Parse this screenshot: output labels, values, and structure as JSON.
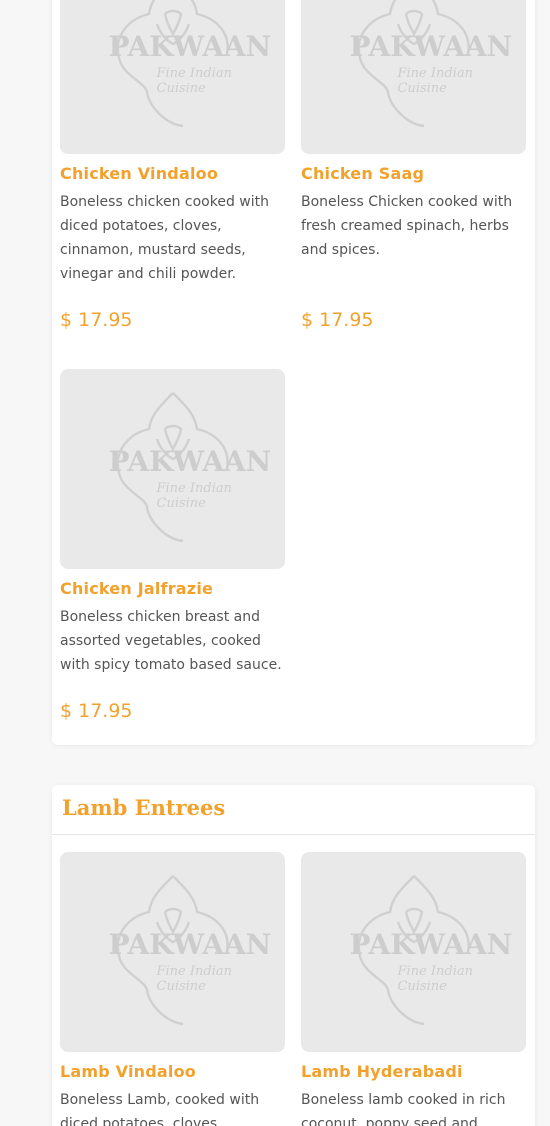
{
  "logo": {
    "brand": "PAKWAAN",
    "tagline": "Fine Indian Cuisine"
  },
  "chicken_items": [
    {
      "name": "Chicken Vindaloo",
      "description": "Boneless chicken cooked with diced potatoes, cloves, cinnamon, mustard seeds, vinegar and chili powder.",
      "price": "$ 17.95"
    },
    {
      "name": "Chicken Saag",
      "description": "Boneless Chicken cooked with fresh creamed spinach, herbs and spices.",
      "price": "$ 17.95"
    },
    {
      "name": "Chicken Jalfrazie",
      "description": "Boneless chicken breast and assorted vegetables, cooked with spicy tomato based sauce.",
      "price": "$ 17.95"
    }
  ],
  "lamb_section": {
    "title": "Lamb Entrees",
    "items": [
      {
        "name": "Lamb Vindaloo",
        "description": "Boneless Lamb, cooked with diced potatoes, cloves,"
      },
      {
        "name": "Lamb Hyderabadi",
        "description": "Boneless lamb cooked in rich coconut, poppy seed and"
      }
    ]
  }
}
